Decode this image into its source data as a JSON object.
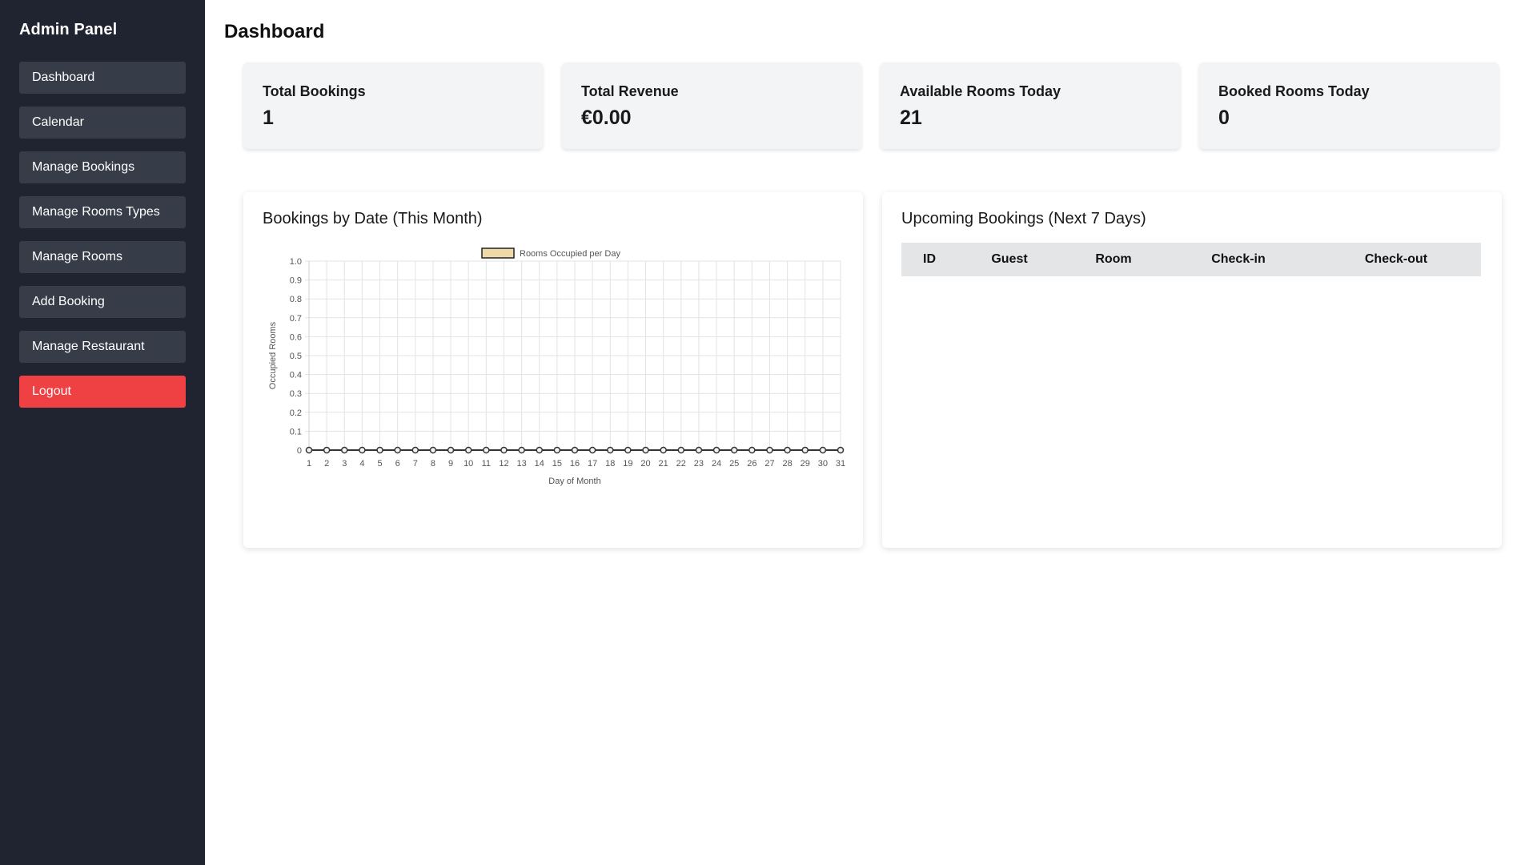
{
  "sidebar": {
    "title": "Admin Panel",
    "items": [
      {
        "label": "Dashboard"
      },
      {
        "label": "Calendar"
      },
      {
        "label": "Manage Bookings"
      },
      {
        "label": "Manage Rooms Types"
      },
      {
        "label": "Manage Rooms"
      },
      {
        "label": "Add Booking"
      },
      {
        "label": "Manage Restaurant"
      }
    ],
    "logout_label": "Logout"
  },
  "header": {
    "title": "Dashboard"
  },
  "stats": [
    {
      "label": "Total Bookings",
      "value": "1"
    },
    {
      "label": "Total Revenue",
      "value": "€0.00"
    },
    {
      "label": "Available Rooms Today",
      "value": "21"
    },
    {
      "label": "Booked Rooms Today",
      "value": "0"
    }
  ],
  "bookings_chart": {
    "title": "Bookings by Date (This Month)"
  },
  "upcoming": {
    "title": "Upcoming Bookings (Next 7 Days)",
    "columns": [
      "ID",
      "Guest",
      "Room",
      "Check-in",
      "Check-out"
    ]
  },
  "colors": {
    "sidebar_bg": "#1f2430",
    "nav_item_bg": "#373d48",
    "logout_bg": "#ef4044",
    "legend_fill": "#f0d9a8"
  },
  "chart_data": {
    "type": "line",
    "title": "",
    "legend": [
      "Rooms Occupied per Day"
    ],
    "legend_position": "top",
    "xlabel": "Day of Month",
    "ylabel": "Occupied Rooms",
    "categories": [
      "1",
      "2",
      "3",
      "4",
      "5",
      "6",
      "7",
      "8",
      "9",
      "10",
      "11",
      "12",
      "13",
      "14",
      "15",
      "16",
      "17",
      "18",
      "19",
      "20",
      "21",
      "22",
      "23",
      "24",
      "25",
      "26",
      "27",
      "28",
      "29",
      "30",
      "31"
    ],
    "series": [
      {
        "name": "Rooms Occupied per Day",
        "values": [
          0,
          0,
          0,
          0,
          0,
          0,
          0,
          0,
          0,
          0,
          0,
          0,
          0,
          0,
          0,
          0,
          0,
          0,
          0,
          0,
          0,
          0,
          0,
          0,
          0,
          0,
          0,
          0,
          0,
          0,
          0
        ]
      }
    ],
    "ylim": [
      0,
      1.0
    ],
    "yticks": [
      "0",
      "0.1",
      "0.2",
      "0.3",
      "0.4",
      "0.5",
      "0.6",
      "0.7",
      "0.8",
      "0.9",
      "1.0"
    ],
    "grid": true
  }
}
